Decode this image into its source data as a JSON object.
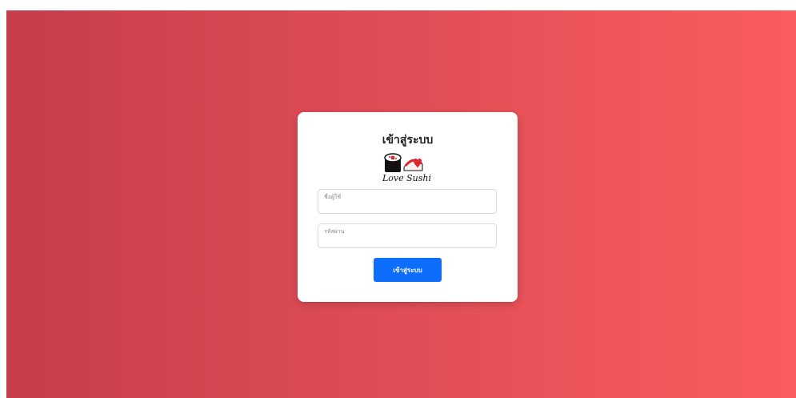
{
  "login": {
    "title": "เข้าสู่ระบบ",
    "logo_text": "Love Sushi",
    "username_label": "ชื่อผู้ใช้",
    "password_label": "รหัสผ่าน",
    "submit_label": "เข้าสู่ระบบ"
  },
  "colors": {
    "background_gradient_start": "#c73d4a",
    "background_gradient_end": "#f95c5c",
    "button_blue": "#0d6efd",
    "logo_red": "#e0262c"
  },
  "icons": [
    "sushi-roll-icon",
    "salmon-nigiri-icon",
    "heart-icon"
  ]
}
